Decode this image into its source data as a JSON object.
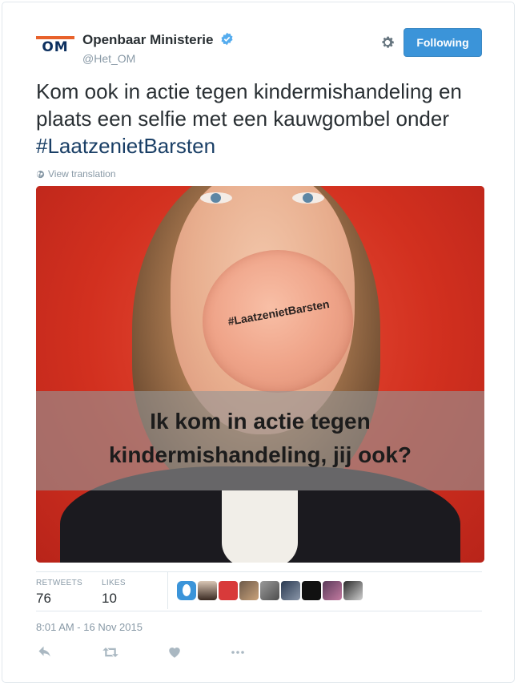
{
  "account": {
    "name": "Openbaar Ministerie",
    "handle": "@Het_OM",
    "logo_text": "OM",
    "follow_label": "Following"
  },
  "tweet": {
    "text_before": "Kom ook in actie tegen kindermishandeling en plaats een selfie met een kauwgombel onder ",
    "hashtag": "#LaatzenietBarsten",
    "translate_label": "View translation"
  },
  "image": {
    "bubble_text": "#LaatzenietBarsten",
    "band_line1": "Ik kom in actie tegen",
    "band_line2": "kindermishandeling, jij ook?"
  },
  "stats": {
    "retweets_label": "RETWEETS",
    "retweets_value": "76",
    "likes_label": "LIKES",
    "likes_value": "10"
  },
  "timestamp": "8:01 AM - 16 Nov 2015",
  "colors": {
    "follow_button": "#3b94d9",
    "hashtag": "#1a3f66",
    "logo_bar": "#e8622b",
    "logo_text": "#0c3060",
    "verified": "#55acee"
  },
  "icons": [
    "verified-badge-icon",
    "gear-icon",
    "globe-icon",
    "reply-icon",
    "retweet-icon",
    "like-icon",
    "more-icon"
  ]
}
